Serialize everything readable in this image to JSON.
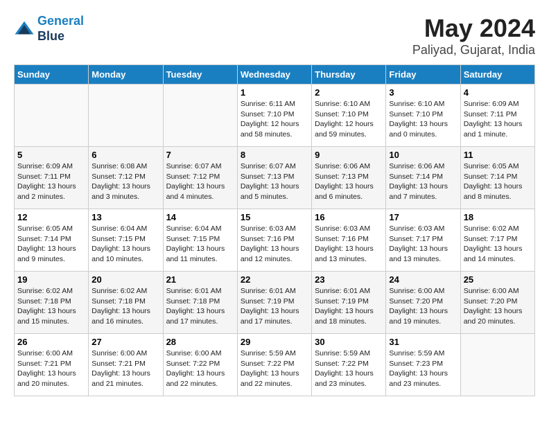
{
  "header": {
    "logo_line1": "General",
    "logo_line2": "Blue",
    "month": "May 2024",
    "location": "Paliyad, Gujarat, India"
  },
  "weekdays": [
    "Sunday",
    "Monday",
    "Tuesday",
    "Wednesday",
    "Thursday",
    "Friday",
    "Saturday"
  ],
  "weeks": [
    [
      {
        "day": "",
        "sunrise": "",
        "sunset": "",
        "daylight": ""
      },
      {
        "day": "",
        "sunrise": "",
        "sunset": "",
        "daylight": ""
      },
      {
        "day": "",
        "sunrise": "",
        "sunset": "",
        "daylight": ""
      },
      {
        "day": "1",
        "sunrise": "Sunrise: 6:11 AM",
        "sunset": "Sunset: 7:10 PM",
        "daylight": "Daylight: 12 hours and 58 minutes."
      },
      {
        "day": "2",
        "sunrise": "Sunrise: 6:10 AM",
        "sunset": "Sunset: 7:10 PM",
        "daylight": "Daylight: 12 hours and 59 minutes."
      },
      {
        "day": "3",
        "sunrise": "Sunrise: 6:10 AM",
        "sunset": "Sunset: 7:10 PM",
        "daylight": "Daylight: 13 hours and 0 minutes."
      },
      {
        "day": "4",
        "sunrise": "Sunrise: 6:09 AM",
        "sunset": "Sunset: 7:11 PM",
        "daylight": "Daylight: 13 hours and 1 minute."
      }
    ],
    [
      {
        "day": "5",
        "sunrise": "Sunrise: 6:09 AM",
        "sunset": "Sunset: 7:11 PM",
        "daylight": "Daylight: 13 hours and 2 minutes."
      },
      {
        "day": "6",
        "sunrise": "Sunrise: 6:08 AM",
        "sunset": "Sunset: 7:12 PM",
        "daylight": "Daylight: 13 hours and 3 minutes."
      },
      {
        "day": "7",
        "sunrise": "Sunrise: 6:07 AM",
        "sunset": "Sunset: 7:12 PM",
        "daylight": "Daylight: 13 hours and 4 minutes."
      },
      {
        "day": "8",
        "sunrise": "Sunrise: 6:07 AM",
        "sunset": "Sunset: 7:13 PM",
        "daylight": "Daylight: 13 hours and 5 minutes."
      },
      {
        "day": "9",
        "sunrise": "Sunrise: 6:06 AM",
        "sunset": "Sunset: 7:13 PM",
        "daylight": "Daylight: 13 hours and 6 minutes."
      },
      {
        "day": "10",
        "sunrise": "Sunrise: 6:06 AM",
        "sunset": "Sunset: 7:14 PM",
        "daylight": "Daylight: 13 hours and 7 minutes."
      },
      {
        "day": "11",
        "sunrise": "Sunrise: 6:05 AM",
        "sunset": "Sunset: 7:14 PM",
        "daylight": "Daylight: 13 hours and 8 minutes."
      }
    ],
    [
      {
        "day": "12",
        "sunrise": "Sunrise: 6:05 AM",
        "sunset": "Sunset: 7:14 PM",
        "daylight": "Daylight: 13 hours and 9 minutes."
      },
      {
        "day": "13",
        "sunrise": "Sunrise: 6:04 AM",
        "sunset": "Sunset: 7:15 PM",
        "daylight": "Daylight: 13 hours and 10 minutes."
      },
      {
        "day": "14",
        "sunrise": "Sunrise: 6:04 AM",
        "sunset": "Sunset: 7:15 PM",
        "daylight": "Daylight: 13 hours and 11 minutes."
      },
      {
        "day": "15",
        "sunrise": "Sunrise: 6:03 AM",
        "sunset": "Sunset: 7:16 PM",
        "daylight": "Daylight: 13 hours and 12 minutes."
      },
      {
        "day": "16",
        "sunrise": "Sunrise: 6:03 AM",
        "sunset": "Sunset: 7:16 PM",
        "daylight": "Daylight: 13 hours and 13 minutes."
      },
      {
        "day": "17",
        "sunrise": "Sunrise: 6:03 AM",
        "sunset": "Sunset: 7:17 PM",
        "daylight": "Daylight: 13 hours and 13 minutes."
      },
      {
        "day": "18",
        "sunrise": "Sunrise: 6:02 AM",
        "sunset": "Sunset: 7:17 PM",
        "daylight": "Daylight: 13 hours and 14 minutes."
      }
    ],
    [
      {
        "day": "19",
        "sunrise": "Sunrise: 6:02 AM",
        "sunset": "Sunset: 7:18 PM",
        "daylight": "Daylight: 13 hours and 15 minutes."
      },
      {
        "day": "20",
        "sunrise": "Sunrise: 6:02 AM",
        "sunset": "Sunset: 7:18 PM",
        "daylight": "Daylight: 13 hours and 16 minutes."
      },
      {
        "day": "21",
        "sunrise": "Sunrise: 6:01 AM",
        "sunset": "Sunset: 7:18 PM",
        "daylight": "Daylight: 13 hours and 17 minutes."
      },
      {
        "day": "22",
        "sunrise": "Sunrise: 6:01 AM",
        "sunset": "Sunset: 7:19 PM",
        "daylight": "Daylight: 13 hours and 17 minutes."
      },
      {
        "day": "23",
        "sunrise": "Sunrise: 6:01 AM",
        "sunset": "Sunset: 7:19 PM",
        "daylight": "Daylight: 13 hours and 18 minutes."
      },
      {
        "day": "24",
        "sunrise": "Sunrise: 6:00 AM",
        "sunset": "Sunset: 7:20 PM",
        "daylight": "Daylight: 13 hours and 19 minutes."
      },
      {
        "day": "25",
        "sunrise": "Sunrise: 6:00 AM",
        "sunset": "Sunset: 7:20 PM",
        "daylight": "Daylight: 13 hours and 20 minutes."
      }
    ],
    [
      {
        "day": "26",
        "sunrise": "Sunrise: 6:00 AM",
        "sunset": "Sunset: 7:21 PM",
        "daylight": "Daylight: 13 hours and 20 minutes."
      },
      {
        "day": "27",
        "sunrise": "Sunrise: 6:00 AM",
        "sunset": "Sunset: 7:21 PM",
        "daylight": "Daylight: 13 hours and 21 minutes."
      },
      {
        "day": "28",
        "sunrise": "Sunrise: 6:00 AM",
        "sunset": "Sunset: 7:22 PM",
        "daylight": "Daylight: 13 hours and 22 minutes."
      },
      {
        "day": "29",
        "sunrise": "Sunrise: 5:59 AM",
        "sunset": "Sunset: 7:22 PM",
        "daylight": "Daylight: 13 hours and 22 minutes."
      },
      {
        "day": "30",
        "sunrise": "Sunrise: 5:59 AM",
        "sunset": "Sunset: 7:22 PM",
        "daylight": "Daylight: 13 hours and 23 minutes."
      },
      {
        "day": "31",
        "sunrise": "Sunrise: 5:59 AM",
        "sunset": "Sunset: 7:23 PM",
        "daylight": "Daylight: 13 hours and 23 minutes."
      },
      {
        "day": "",
        "sunrise": "",
        "sunset": "",
        "daylight": ""
      }
    ]
  ]
}
